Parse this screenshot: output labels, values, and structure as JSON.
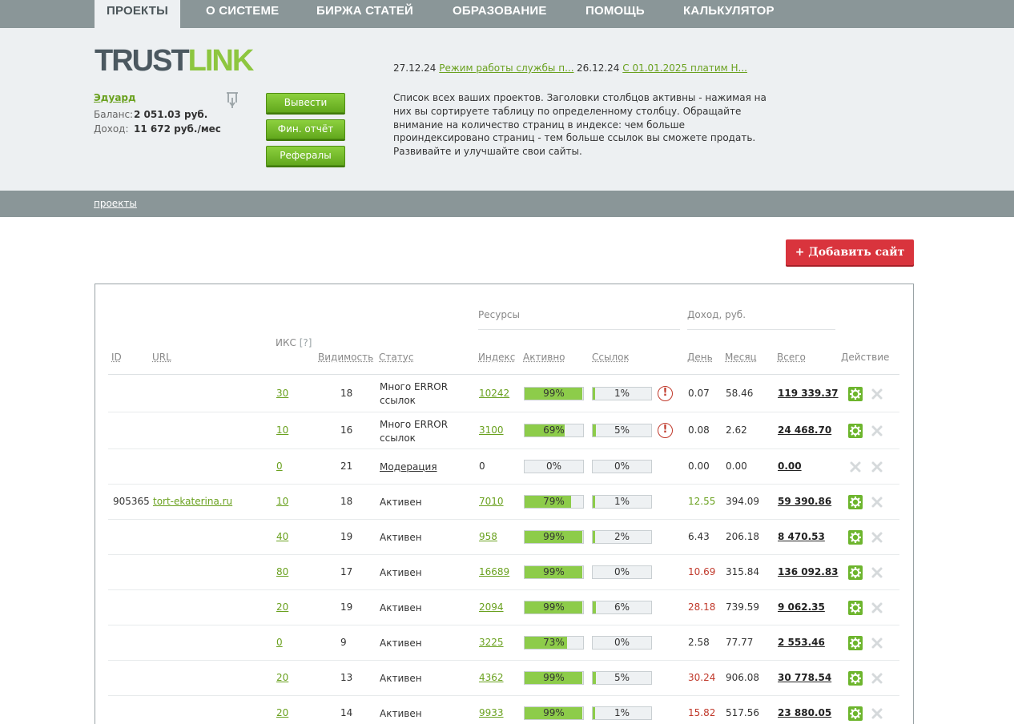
{
  "nav": {
    "tabs": [
      {
        "label": "ПРОЕКТЫ"
      },
      {
        "label": "О СИСТЕМЕ"
      },
      {
        "label": "БИРЖА СТАТЕЙ"
      },
      {
        "label": "ОБРАЗОВАНИЕ"
      },
      {
        "label": "ПОМОЩЬ"
      },
      {
        "label": "КАЛЬКУЛЯТОР"
      }
    ]
  },
  "logo": {
    "part1": "TRUST",
    "part2": "LINK"
  },
  "user": {
    "name": "Эдуард",
    "balance_label": "Баланс:",
    "balance_value": "2 051.03  руб.",
    "income_label": "Доход:",
    "income_value": "11 672 руб./мес"
  },
  "buttons": {
    "withdraw": "Вывести",
    "fin_report": "Фин. отчёт",
    "referrals": "Рефералы",
    "add_site": "+ Добавить сайт"
  },
  "news": [
    {
      "date": "27.12.24",
      "title": "Режим работы службы п..."
    },
    {
      "date": "26.12.24",
      "title": "С 01.01.2025 платим Н..."
    }
  ],
  "description": "Список всех ваших проектов. Заголовки столбцов активны - нажимая на них вы сортируете таблицу по определенному столбцу. Обращайте внимание на количество страниц в индексе: чем больше проиндексировано страниц - тем больше ссылок вы сможете продать. Развивайте и улучшайте свои сайты.",
  "breadcrumb": "проекты",
  "table": {
    "group_resources": "Ресурсы",
    "group_income": "Доход,  руб.",
    "headers": {
      "id": "ID",
      "url": "URL",
      "iks": "ИКС",
      "iks_hint": "[?]",
      "visibility": "Видимость",
      "status": "Статус",
      "index": "Индекс",
      "active": "Активно",
      "links": "Ссылок",
      "day": "День",
      "month": "Месяц",
      "total": "Всего",
      "action": "Действие"
    },
    "rows": [
      {
        "id": "",
        "url": "",
        "iks": "30",
        "vis": "18",
        "status": "Много ERROR ссылок",
        "index": "10242",
        "active": "99%",
        "active_frac": 0.99,
        "links": "1%",
        "links_frac": 0.01,
        "warn": true,
        "day": "0.07",
        "day_color": "normal",
        "month": "58.46",
        "total": "119 339.37",
        "enabled": true
      },
      {
        "id": "",
        "url": "",
        "iks": "10",
        "vis": "16",
        "status": "Много ERROR ссылок",
        "index": "3100",
        "active": "69%",
        "active_frac": 0.69,
        "links": "5%",
        "links_frac": 0.05,
        "warn": true,
        "day": "0.08",
        "day_color": "normal",
        "month": "2.62",
        "total": "24 468.70",
        "enabled": true
      },
      {
        "id": "",
        "url": "",
        "iks": "0",
        "vis": "21",
        "status": "Модерация",
        "index": "0",
        "active": "0%",
        "active_frac": 0,
        "links": "0%",
        "links_frac": 0,
        "warn": false,
        "day": "0.00",
        "day_color": "normal",
        "month": "0.00",
        "total": "0.00",
        "enabled": false
      },
      {
        "id": "905365",
        "url": "tort-ekaterina.ru",
        "iks": "10",
        "vis": "18",
        "status": "Активен",
        "index": "7010",
        "active": "79%",
        "active_frac": 0.79,
        "links": "1%",
        "links_frac": 0.01,
        "warn": false,
        "day": "12.55",
        "day_color": "green",
        "month": "394.09",
        "total": "59 390.86",
        "enabled": true
      },
      {
        "id": "",
        "url": "",
        "iks": "40",
        "vis": "19",
        "status": "Активен",
        "index": "958",
        "active": "99%",
        "active_frac": 0.99,
        "links": "2%",
        "links_frac": 0.02,
        "warn": false,
        "day": "6.43",
        "day_color": "normal",
        "month": "206.18",
        "total": "8 470.53",
        "enabled": true
      },
      {
        "id": "",
        "url": "",
        "iks": "80",
        "vis": "17",
        "status": "Активен",
        "index": "16689",
        "active": "99%",
        "active_frac": 0.99,
        "links": "0%",
        "links_frac": 0,
        "warn": false,
        "day": "10.69",
        "day_color": "red",
        "month": "315.84",
        "total": "136 092.83",
        "enabled": true
      },
      {
        "id": "",
        "url": "",
        "iks": "20",
        "vis": "19",
        "status": "Активен",
        "index": "2094",
        "active": "99%",
        "active_frac": 0.99,
        "links": "6%",
        "links_frac": 0.06,
        "warn": false,
        "day": "28.18",
        "day_color": "red",
        "month": "739.59",
        "total": "9 062.35",
        "enabled": true
      },
      {
        "id": "",
        "url": "",
        "iks": "0",
        "vis": "9",
        "status": "Активен",
        "index": "3225",
        "active": "73%",
        "active_frac": 0.73,
        "links": "0%",
        "links_frac": 0,
        "warn": false,
        "day": "2.58",
        "day_color": "normal",
        "month": "77.77",
        "total": "2 553.46",
        "enabled": true
      },
      {
        "id": "",
        "url": "",
        "iks": "20",
        "vis": "13",
        "status": "Активен",
        "index": "4362",
        "active": "99%",
        "active_frac": 0.99,
        "links": "5%",
        "links_frac": 0.05,
        "warn": false,
        "day": "30.24",
        "day_color": "red",
        "month": "906.08",
        "total": "30 778.54",
        "enabled": true
      },
      {
        "id": "",
        "url": "",
        "iks": "20",
        "vis": "14",
        "status": "Активен",
        "index": "9933",
        "active": "99%",
        "active_frac": 0.99,
        "links": "1%",
        "links_frac": 0.01,
        "warn": false,
        "day": "15.82",
        "day_color": "red",
        "month": "517.56",
        "total": "23 880.05",
        "enabled": true
      }
    ]
  }
}
